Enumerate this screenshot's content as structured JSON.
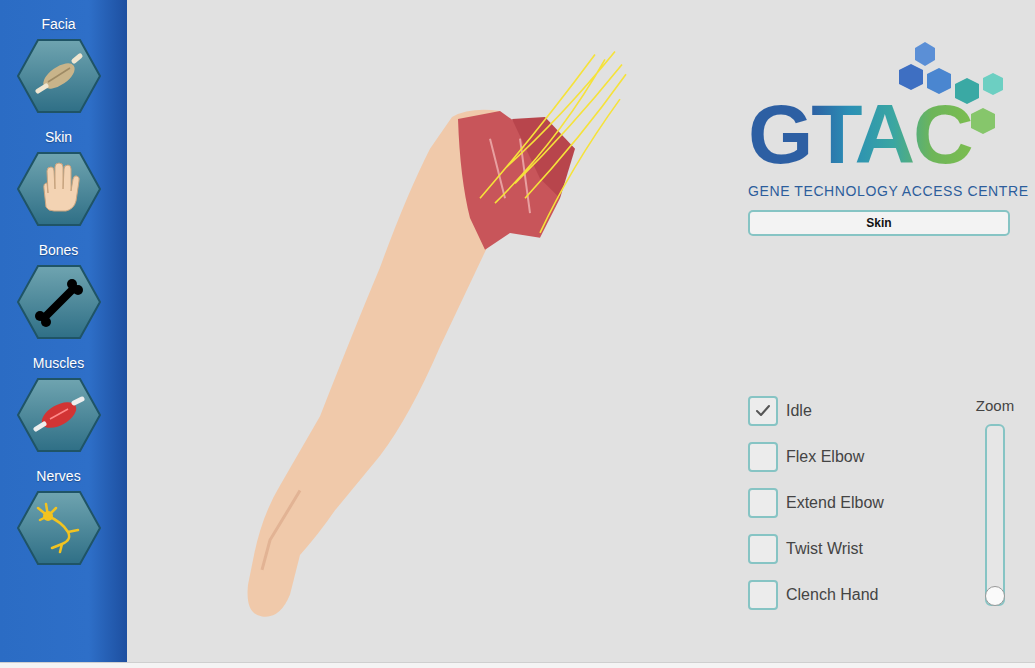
{
  "sidebar": {
    "items": [
      {
        "label": "Facia",
        "kind": "fascia"
      },
      {
        "label": "Skin",
        "kind": "skin"
      },
      {
        "label": "Bones",
        "kind": "bone"
      },
      {
        "label": "Muscles",
        "kind": "muscle"
      },
      {
        "label": "Nerves",
        "kind": "nerve"
      }
    ]
  },
  "logo": {
    "title": "GTAC",
    "subtitle": "GENE TECHNOLOGY ACCESS CENTRE"
  },
  "layer_button": "Skin",
  "animations": [
    {
      "label": "Idle",
      "checked": true
    },
    {
      "label": "Flex Elbow",
      "checked": false
    },
    {
      "label": "Extend Elbow",
      "checked": false
    },
    {
      "label": "Twist Wrist",
      "checked": false
    },
    {
      "label": "Clench Hand",
      "checked": false
    }
  ],
  "zoom": {
    "label": "Zoom",
    "level": 0
  }
}
